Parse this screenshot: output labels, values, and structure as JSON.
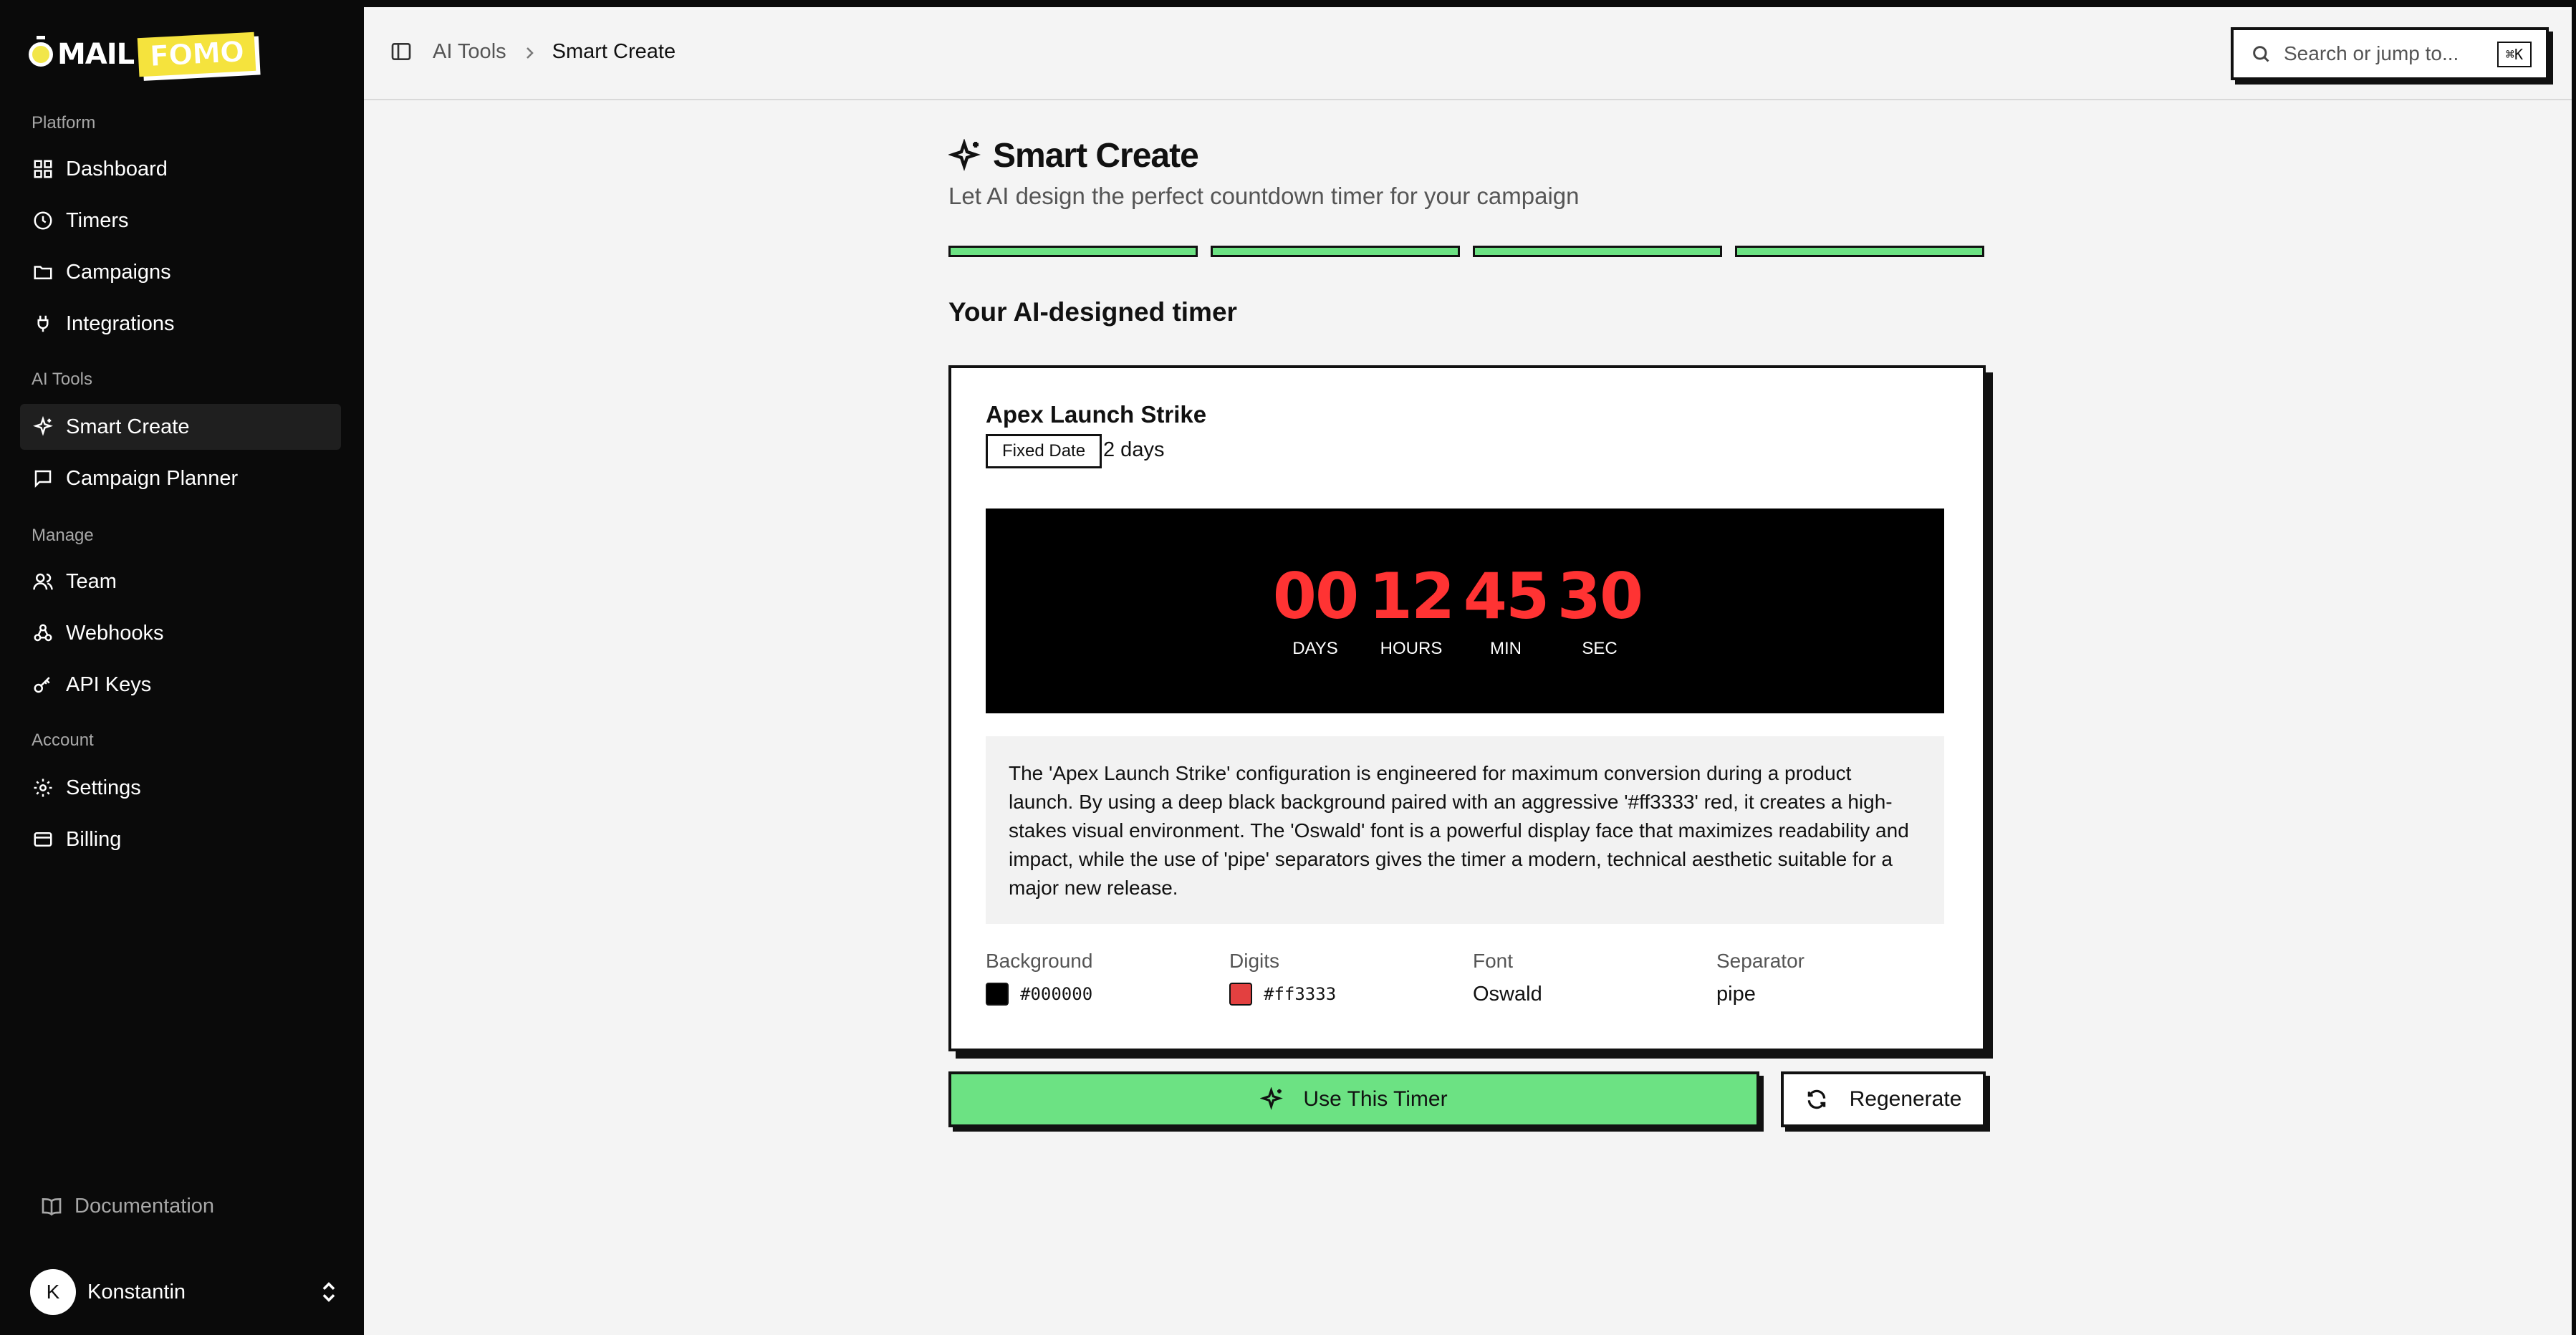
{
  "brand": {
    "mail": "MAIL",
    "fomo": "FOMO"
  },
  "sidebar": {
    "sections": [
      {
        "label": "Platform",
        "items": [
          {
            "label": "Dashboard",
            "icon": "grid-icon"
          },
          {
            "label": "Timers",
            "icon": "clock-icon"
          },
          {
            "label": "Campaigns",
            "icon": "folder-icon"
          },
          {
            "label": "Integrations",
            "icon": "plug-icon"
          }
        ]
      },
      {
        "label": "AI Tools",
        "items": [
          {
            "label": "Smart Create",
            "icon": "sparkle-icon",
            "active": true
          },
          {
            "label": "Campaign Planner",
            "icon": "message-icon"
          }
        ]
      },
      {
        "label": "Manage",
        "items": [
          {
            "label": "Team",
            "icon": "users-icon"
          },
          {
            "label": "Webhooks",
            "icon": "webhook-icon"
          },
          {
            "label": "API Keys",
            "icon": "key-icon"
          }
        ]
      },
      {
        "label": "Account",
        "items": [
          {
            "label": "Settings",
            "icon": "gear-icon"
          },
          {
            "label": "Billing",
            "icon": "credit-card-icon"
          }
        ]
      }
    ],
    "docs_label": "Documentation",
    "user": {
      "initial": "K",
      "name": "Konstantin"
    }
  },
  "topbar": {
    "breadcrumb": [
      "AI Tools",
      "Smart Create"
    ],
    "search_placeholder": "Search or jump to...",
    "search_shortcut": "⌘K"
  },
  "page": {
    "title": "Smart Create",
    "subtitle": "Let AI design the perfect countdown timer for your campaign",
    "steps_total": 4,
    "steps_completed": 4,
    "section_title": "Your AI-designed timer"
  },
  "timer": {
    "name": "Apex Launch Strike",
    "type_badge": "Fixed Date",
    "duration": "2 days",
    "units": [
      {
        "value": "00",
        "label": "DAYS"
      },
      {
        "value": "12",
        "label": "HOURS"
      },
      {
        "value": "45",
        "label": "MIN"
      },
      {
        "value": "30",
        "label": "SEC"
      }
    ],
    "description": "The 'Apex Launch Strike' configuration is engineered for maximum conversion during a product launch. By using a deep black background paired with an aggressive '#ff3333' red, it creates a high-stakes visual environment. The 'Oswald' font is a powerful display face that maximizes readability and impact, while the use of 'pipe' separators gives the timer a modern, technical aesthetic suitable for a major new release.",
    "props": {
      "background_label": "Background",
      "background_value": "#000000",
      "digits_label": "Digits",
      "digits_value": "#ff3333",
      "font_label": "Font",
      "font_value": "Oswald",
      "separator_label": "Separator",
      "separator_value": "pipe"
    }
  },
  "actions": {
    "use": "Use This Timer",
    "regenerate": "Regenerate"
  },
  "colors": {
    "accent": "#6ce283",
    "digits": "#ff3333",
    "timer_bg": "#000000",
    "brand_yellow": "#f5e33d"
  }
}
